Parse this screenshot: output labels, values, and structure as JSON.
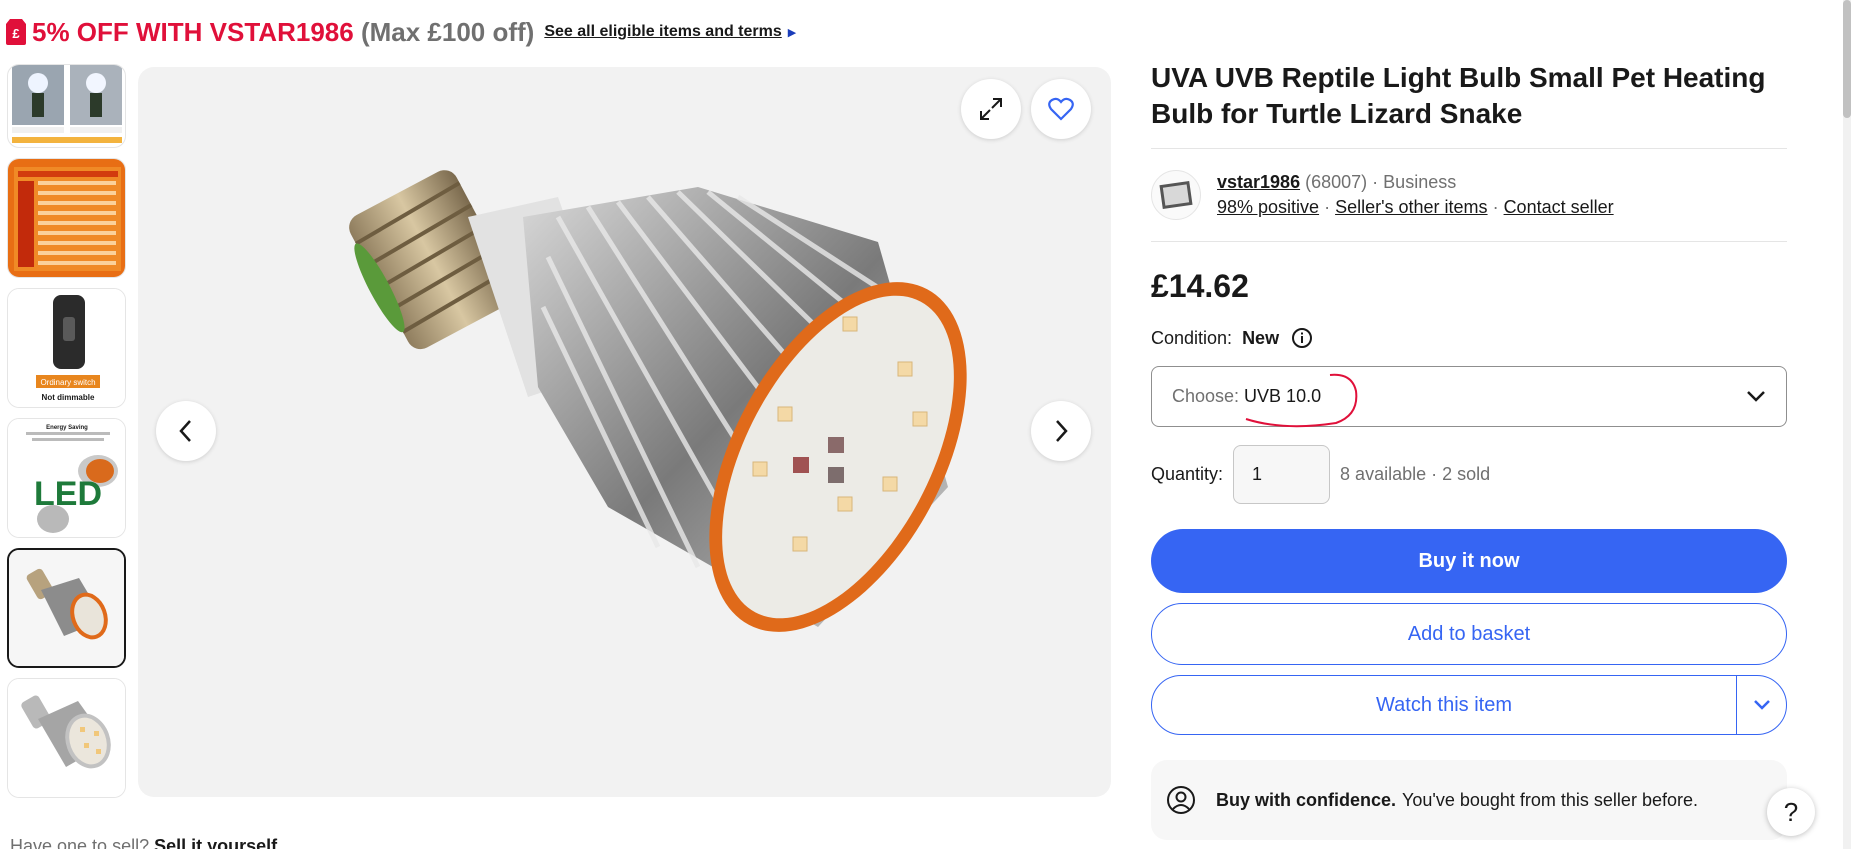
{
  "promo": {
    "discount": "5% OFF WITH",
    "code": "VSTAR1986",
    "max": "(Max £100 off)",
    "link": "See all eligible items and terms",
    "tag_icon": "price-tag-icon"
  },
  "gallery": {
    "thumbnails": [
      {
        "caption": "",
        "icon": "bulbs-comparison-thumb"
      },
      {
        "caption": "",
        "icon": "uv-chart-thumb"
      },
      {
        "caption_1": "Ordinary switch",
        "caption_2": "Not dimmable",
        "icon": "switch-thumb"
      },
      {
        "caption_1": "Energy Saving",
        "big_text": "LED",
        "icon": "led-bulbs-thumb"
      },
      {
        "caption": "",
        "icon": "orange-bulb-thumb",
        "selected": true
      },
      {
        "caption": "",
        "icon": "silver-bulb-thumb"
      }
    ],
    "controls": {
      "expand_icon": "expand-icon",
      "watch_icon": "heart-icon",
      "prev_icon": "chevron-left-icon",
      "next_icon": "chevron-right-icon"
    }
  },
  "product": {
    "title": "UVA UVB Reptile Light Bulb Small Pet Heating Bulb for Turtle Lizard Snake",
    "seller": {
      "name": "vstar1986",
      "feedback_count": "(68007)",
      "type": "Business",
      "positive": "98% positive",
      "other_items": "Seller's other items",
      "contact": "Contact seller"
    },
    "price": "£14.62",
    "condition_label": "Condition:",
    "condition_value": "New",
    "choose_label": "Choose:",
    "choose_value": "UVB 10.0",
    "quantity_label": "Quantity:",
    "quantity_value": "1",
    "availability": "8 available · 2 sold",
    "buy_now": "Buy it now",
    "add_to_basket": "Add to basket",
    "watch": "Watch this item",
    "confidence_bold": "Buy with confidence.",
    "confidence_text": "You've bought from this seller before."
  },
  "bottom": {
    "text": "Have one to sell?",
    "link": "Sell it yourself"
  },
  "help": "?",
  "colors": {
    "accent": "#3665f3",
    "promo_red": "#e0103a",
    "bulb_orange": "#e06a1a"
  }
}
